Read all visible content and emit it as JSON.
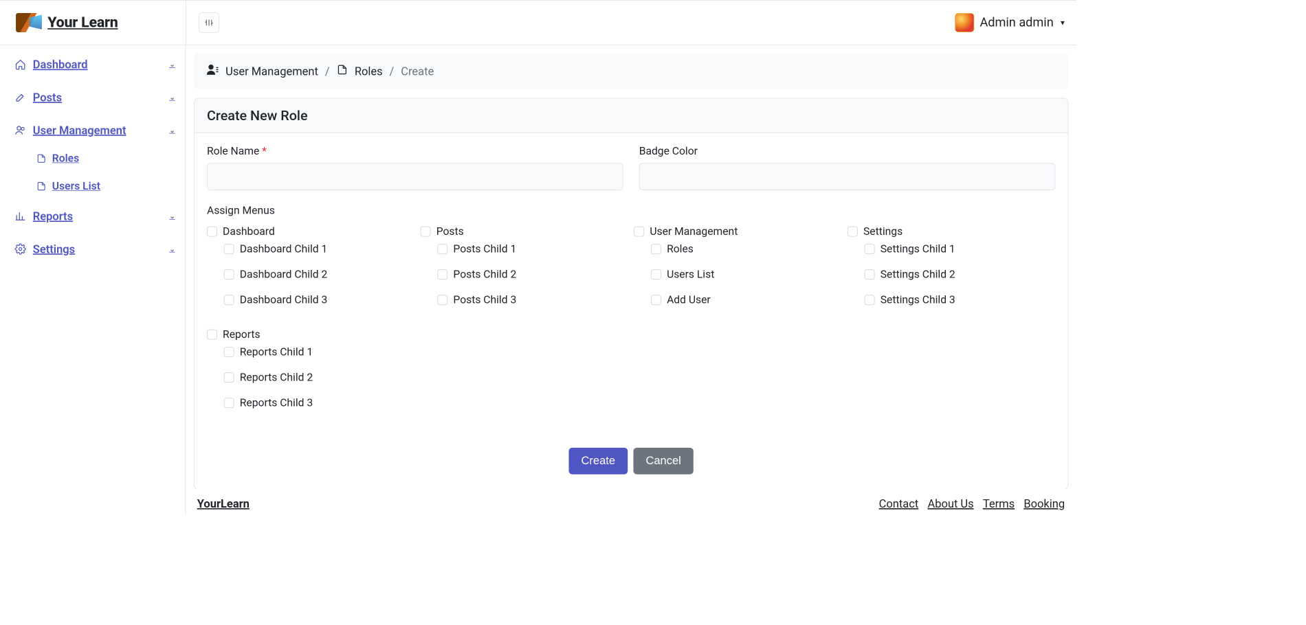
{
  "brand": {
    "title": "Your Learn",
    "footer_brand": "YourLearn"
  },
  "header": {
    "username": "Admin admin"
  },
  "sidebar": {
    "items": [
      {
        "label": "Dashboard"
      },
      {
        "label": "Posts"
      },
      {
        "label": "User Management"
      },
      {
        "label": "Reports"
      },
      {
        "label": "Settings"
      }
    ],
    "user_mgmt_children": [
      {
        "label": "Roles"
      },
      {
        "label": "Users List"
      }
    ]
  },
  "breadcrumb": {
    "seg1": "User Management",
    "seg2": "Roles",
    "seg3": "Create"
  },
  "page": {
    "card_title": "Create New Role",
    "role_name_label": "Role Name",
    "badge_color_label": "Badge Color",
    "assign_menus_label": "Assign Menus",
    "create_btn": "Create",
    "cancel_btn": "Cancel"
  },
  "menus": [
    {
      "name": "Dashboard",
      "children": [
        "Dashboard Child 1",
        "Dashboard Child 2",
        "Dashboard Child 3"
      ]
    },
    {
      "name": "Posts",
      "children": [
        "Posts Child 1",
        "Posts Child 2",
        "Posts Child 3"
      ]
    },
    {
      "name": "User Management",
      "children": [
        "Roles",
        "Users List",
        "Add User"
      ]
    },
    {
      "name": "Settings",
      "children": [
        "Settings Child 1",
        "Settings Child 2",
        "Settings Child 3"
      ]
    },
    {
      "name": "Reports",
      "children": [
        "Reports Child 1",
        "Reports Child 2",
        "Reports Child 3"
      ]
    }
  ],
  "footer_links": {
    "contact": "Contact",
    "about": "About Us",
    "terms": "Terms",
    "booking": "Booking"
  }
}
